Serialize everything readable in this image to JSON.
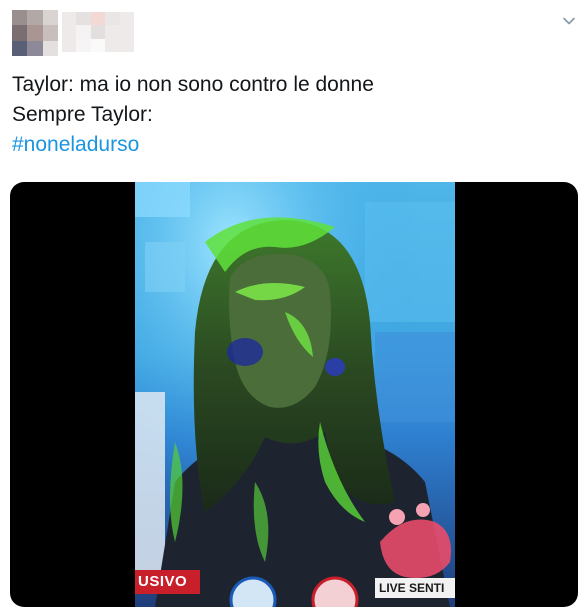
{
  "tweet": {
    "header": {
      "avatar_icon": "blurred-avatar",
      "username_label": "",
      "menu_icon": "chevron-down-icon"
    },
    "text_line_1": "Taylor: ma io non sono contro le donne",
    "text_line_2": "Sempre Taylor:",
    "hashtag": "#noneladurso",
    "media": {
      "overlay_left": "USIVO",
      "overlay_right": "LIVE SENTI"
    }
  },
  "colors": {
    "text": "#14171a",
    "hashtag": "#1b95e0",
    "media_bg": "#000000",
    "slime": "#5fe23a",
    "banner_red": "#c81f2b"
  }
}
